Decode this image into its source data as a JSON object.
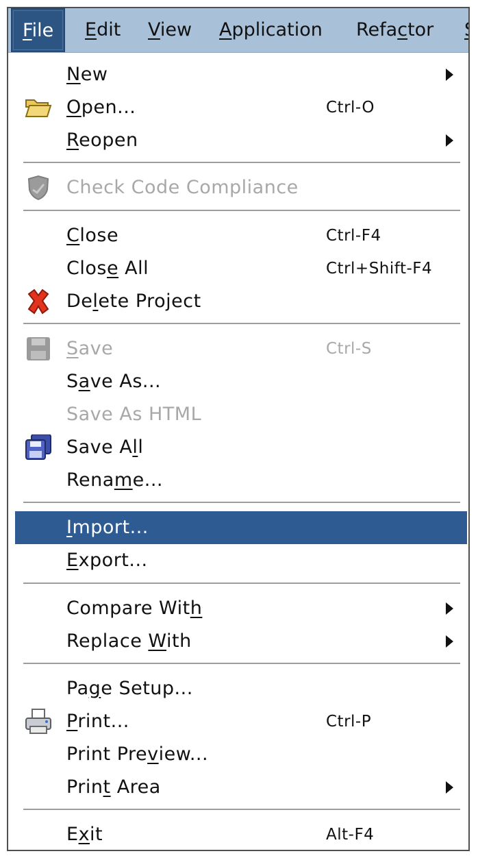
{
  "menubar": {
    "items": [
      {
        "pre": "",
        "ul": "F",
        "post": "ile"
      },
      {
        "pre": "",
        "ul": "E",
        "post": "dit"
      },
      {
        "pre": "",
        "ul": "V",
        "post": "iew"
      },
      {
        "pre": "",
        "ul": "A",
        "post": "pplication"
      },
      {
        "pre": "Refa",
        "ul": "c",
        "post": "tor"
      },
      {
        "pre": "",
        "ul": "S",
        "post": ""
      }
    ]
  },
  "menu": {
    "new": {
      "pre": "",
      "ul": "N",
      "post": "ew"
    },
    "open": {
      "pre": "",
      "ul": "O",
      "post": "pen...",
      "accel": "Ctrl-O"
    },
    "reopen": {
      "pre": "",
      "ul": "R",
      "post": "eopen"
    },
    "check_code_compliance": {
      "label": "Check Code Compliance"
    },
    "close": {
      "pre": "",
      "ul": "C",
      "post": "lose",
      "accel": "Ctrl-F4"
    },
    "close_all": {
      "pre": "Clos",
      "ul": "e",
      "post": " All",
      "accel": "Ctrl+Shift-F4"
    },
    "delete_project": {
      "pre": "De",
      "ul": "l",
      "post": "ete Project"
    },
    "save": {
      "pre": "",
      "ul": "S",
      "post": "ave",
      "accel": "Ctrl-S"
    },
    "save_as": {
      "pre": "S",
      "ul": "a",
      "post": "ve As..."
    },
    "save_as_html": {
      "label": "Save As HTML"
    },
    "save_all": {
      "pre": "Save A",
      "ul": "l",
      "post": "l"
    },
    "rename": {
      "pre": "Rena",
      "ul": "m",
      "post": "e..."
    },
    "import": {
      "pre": "",
      "ul": "I",
      "post": "mport..."
    },
    "export": {
      "pre": "",
      "ul": "E",
      "post": "xport..."
    },
    "compare_with": {
      "pre": "Compare Wit",
      "ul": "h",
      "post": ""
    },
    "replace_with": {
      "pre": "Replace ",
      "ul": "W",
      "post": "ith"
    },
    "page_setup": {
      "pre": "Pa",
      "ul": "g",
      "post": "e Setup..."
    },
    "print": {
      "pre": "",
      "ul": "P",
      "post": "rint...",
      "accel": "Ctrl-P"
    },
    "print_preview": {
      "pre": "Print Pre",
      "ul": "v",
      "post": "iew..."
    },
    "print_area": {
      "pre": "Prin",
      "ul": "t",
      "post": " Area"
    },
    "exit": {
      "pre": "E",
      "ul": "x",
      "post": "it",
      "accel": "Alt-F4"
    }
  },
  "colors": {
    "menubar_bg": "#a9c0d9",
    "active_menu_bg": "#2c5584",
    "highlight_bg": "#2e5c92",
    "disabled_text": "#a8a8a8"
  },
  "icons": {
    "open": "folder-icon",
    "check_code_compliance": "shield-icon",
    "delete_project": "red-x-icon",
    "save": "disk-icon",
    "save_all": "disks-icon",
    "print": "printer-icon"
  }
}
